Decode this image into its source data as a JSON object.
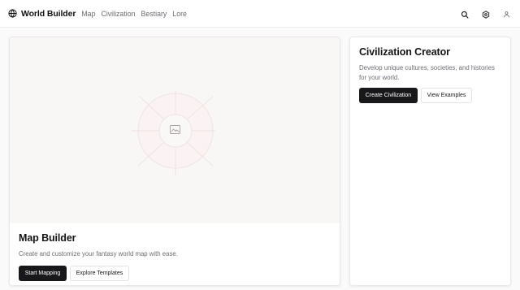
{
  "header": {
    "brand_title": "World Builder",
    "brand_icon": "globe-icon",
    "nav": [
      "Map",
      "Civilization",
      "Bestiary",
      "Lore"
    ],
    "actions": [
      "search-icon",
      "settings-icon",
      "user-icon"
    ]
  },
  "map_card": {
    "preview_icon": "image-icon",
    "title": "Map Builder",
    "description": "Create and customize your fantasy world map with ease.",
    "primary_button": "Start Mapping",
    "secondary_button": "Explore Templates"
  },
  "civ_card": {
    "title": "Civilization Creator",
    "description": "Develop unique cultures, societies, and histories for your world.",
    "primary_button": "Create Civilization",
    "secondary_button": "View Examples"
  },
  "colors": {
    "primary": "#18181b",
    "preview_background": "#f9f6f6",
    "muted_text": "#6e6e76"
  }
}
